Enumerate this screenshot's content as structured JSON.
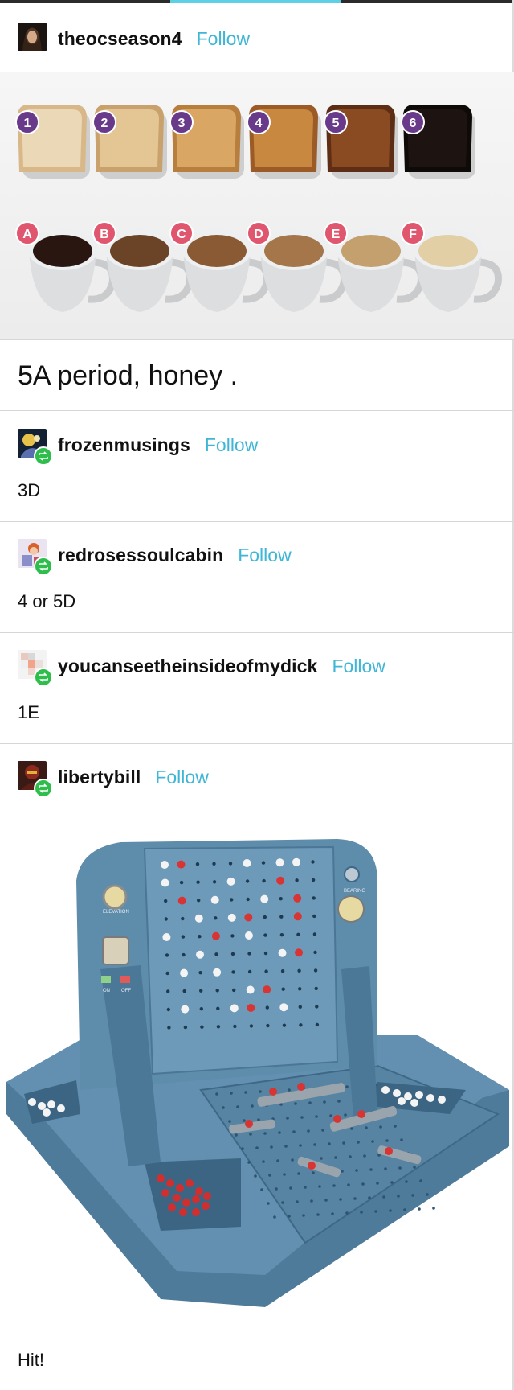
{
  "posts": [
    {
      "username": "theocseason4",
      "follow": "Follow",
      "reblog": false
    },
    {
      "username": "frozenmusings",
      "follow": "Follow",
      "reblog": true,
      "text": "3D"
    },
    {
      "username": "redrosessoulcabin",
      "follow": "Follow",
      "reblog": true,
      "text": "4 or 5D"
    },
    {
      "username": "youcanseetheinsideofmydick",
      "follow": "Follow",
      "reblog": true,
      "text": "1E"
    },
    {
      "username": "libertybill",
      "follow": "Follow",
      "reblog": true,
      "text": "Hit!"
    }
  ],
  "op_caption": "5A period, honey .",
  "toast_labels": [
    "1",
    "2",
    "3",
    "4",
    "5",
    "6"
  ],
  "coffee_labels": [
    "A",
    "B",
    "C",
    "D",
    "E",
    "F"
  ],
  "board_labels": {
    "elevation": "ELEVATION",
    "on": "ON",
    "off": "OFF",
    "bearing": "BEARING"
  },
  "colors": {
    "follow": "#3fb6d6",
    "reblog_badge": "#2fbd4b",
    "badge_purple": "#6a3a8a",
    "badge_pink": "#e0566e",
    "board_blue": "#5b87a6"
  }
}
